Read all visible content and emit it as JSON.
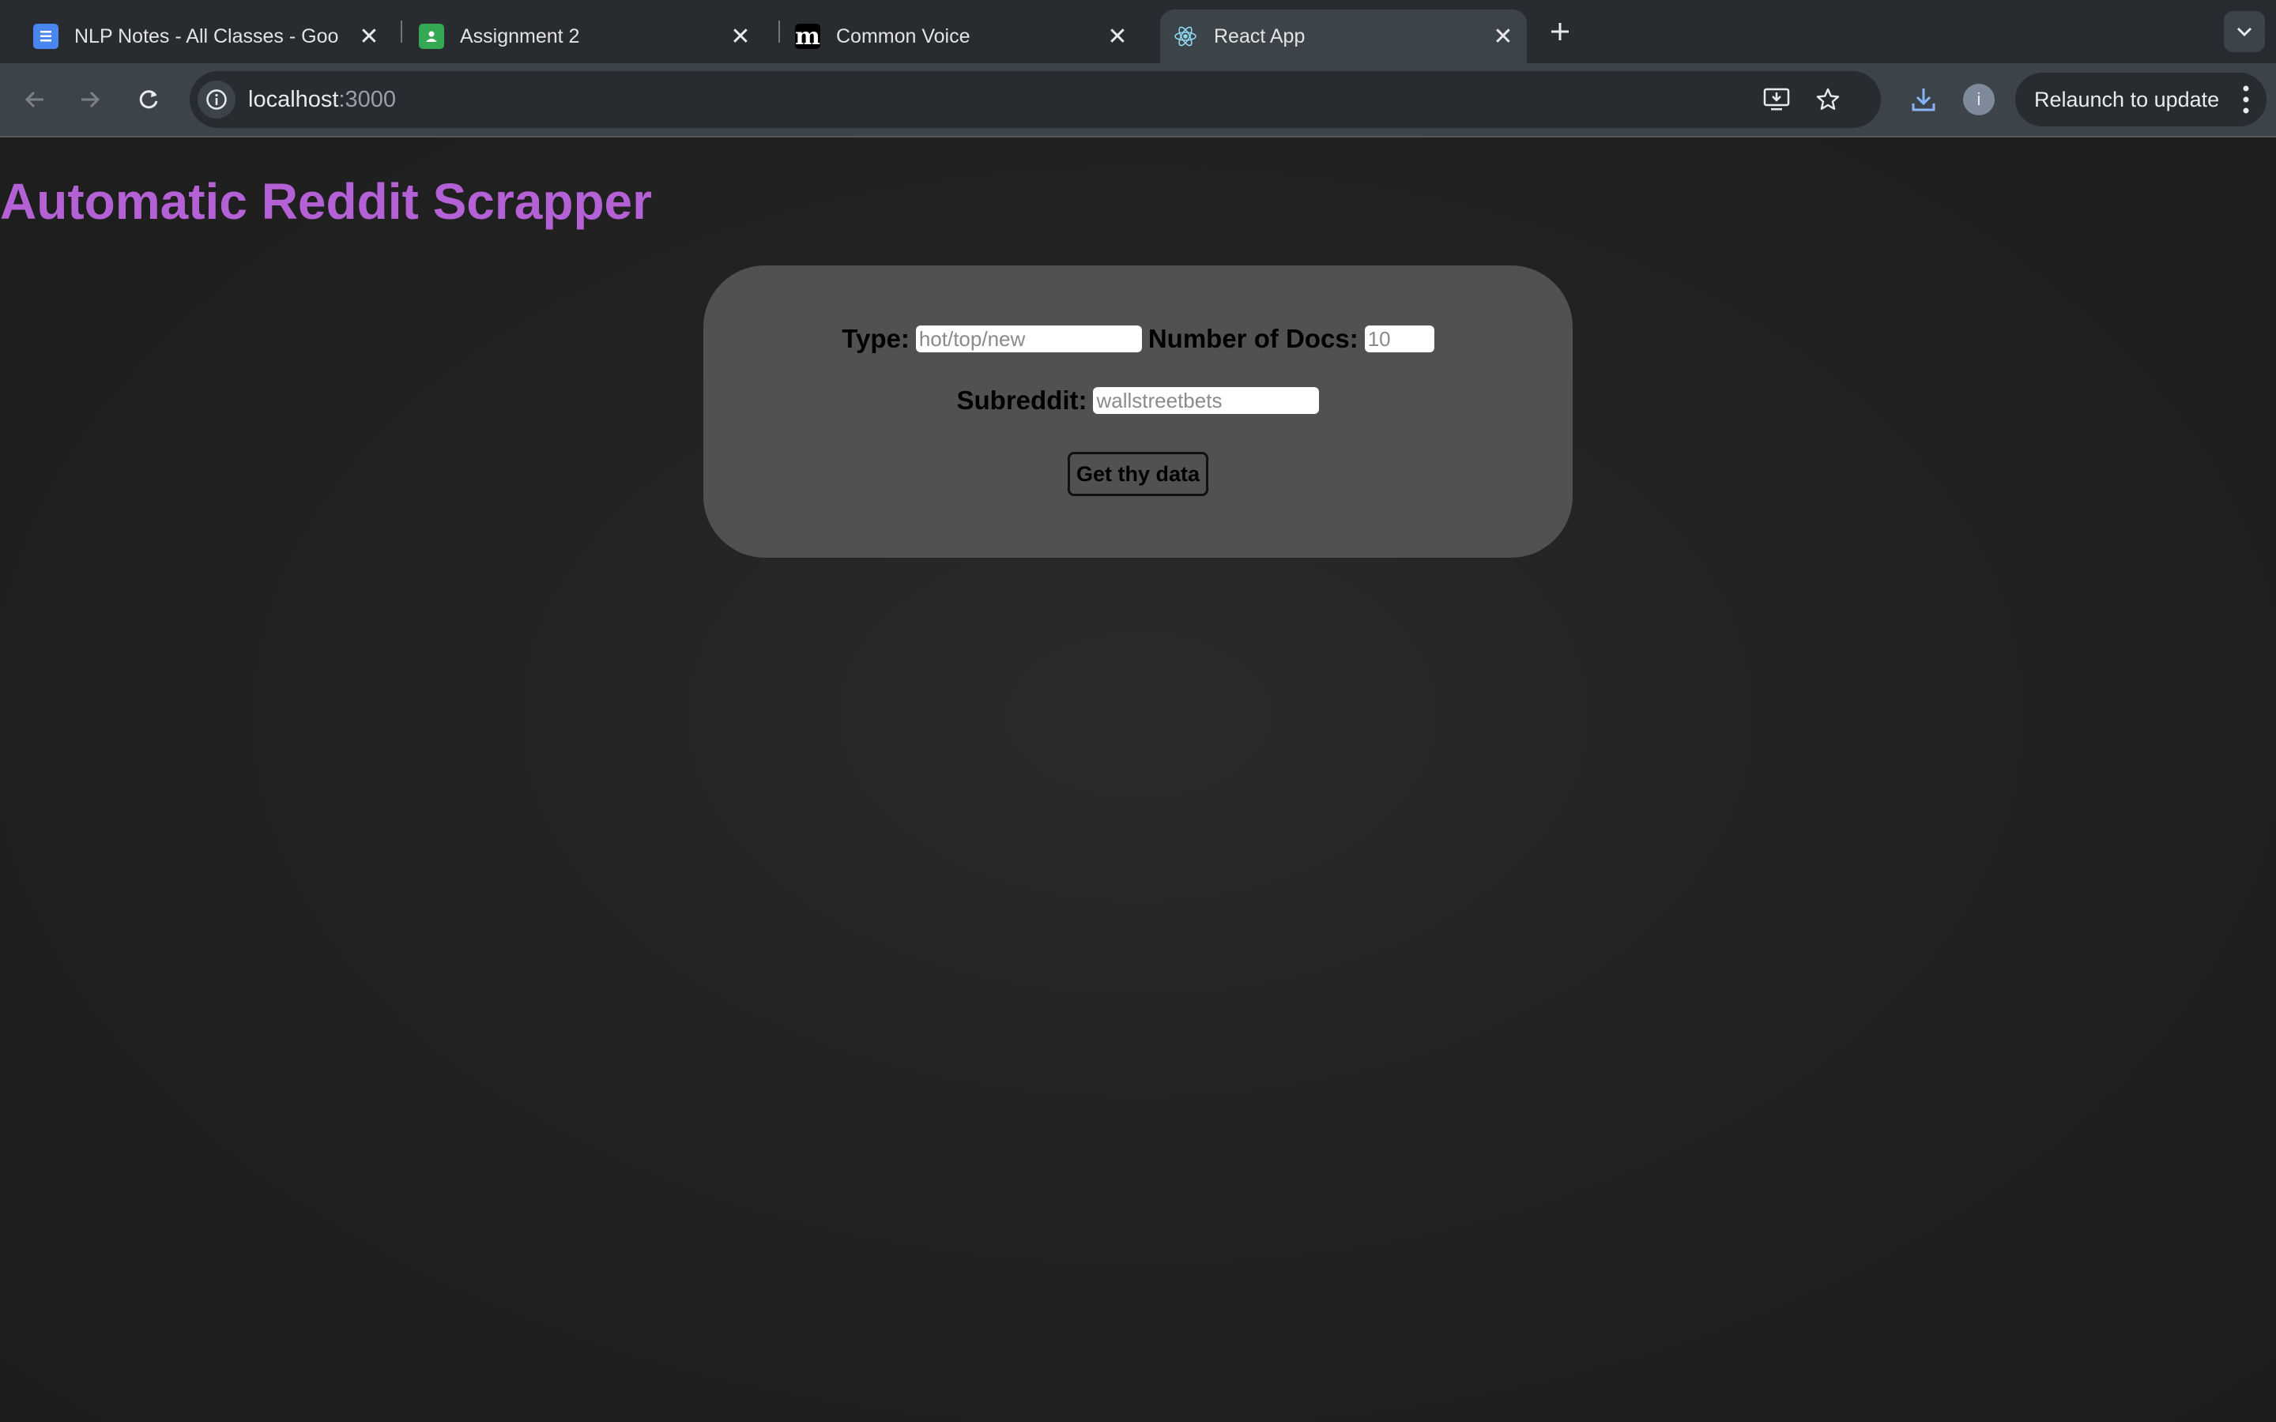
{
  "browser": {
    "tabs": [
      {
        "title": "NLP Notes - All Classes - Goo",
        "icon": "google-docs-icon",
        "active": false
      },
      {
        "title": "Assignment 2",
        "icon": "google-classroom-icon",
        "active": false
      },
      {
        "title": "Common Voice",
        "icon": "common-voice-icon",
        "active": false
      },
      {
        "title": "React App",
        "icon": "react-icon",
        "active": true
      }
    ],
    "address": {
      "host": "localhost",
      "port": ":3000"
    },
    "relaunch_label": "Relaunch to update",
    "profile_initial": "i",
    "colors": {
      "chrome": "#282c30",
      "toolbar": "#3c4449",
      "accent_title": "#b561d6"
    }
  },
  "page": {
    "title": "Automatic Reddit Scrapper",
    "form": {
      "type_label": "Type:",
      "type_placeholder": "hot/top/new",
      "docs_label": "Number of Docs:",
      "docs_placeholder": "10",
      "subreddit_label": "Subreddit:",
      "subreddit_placeholder": "wallstreetbets",
      "submit_label": "Get thy data"
    }
  }
}
